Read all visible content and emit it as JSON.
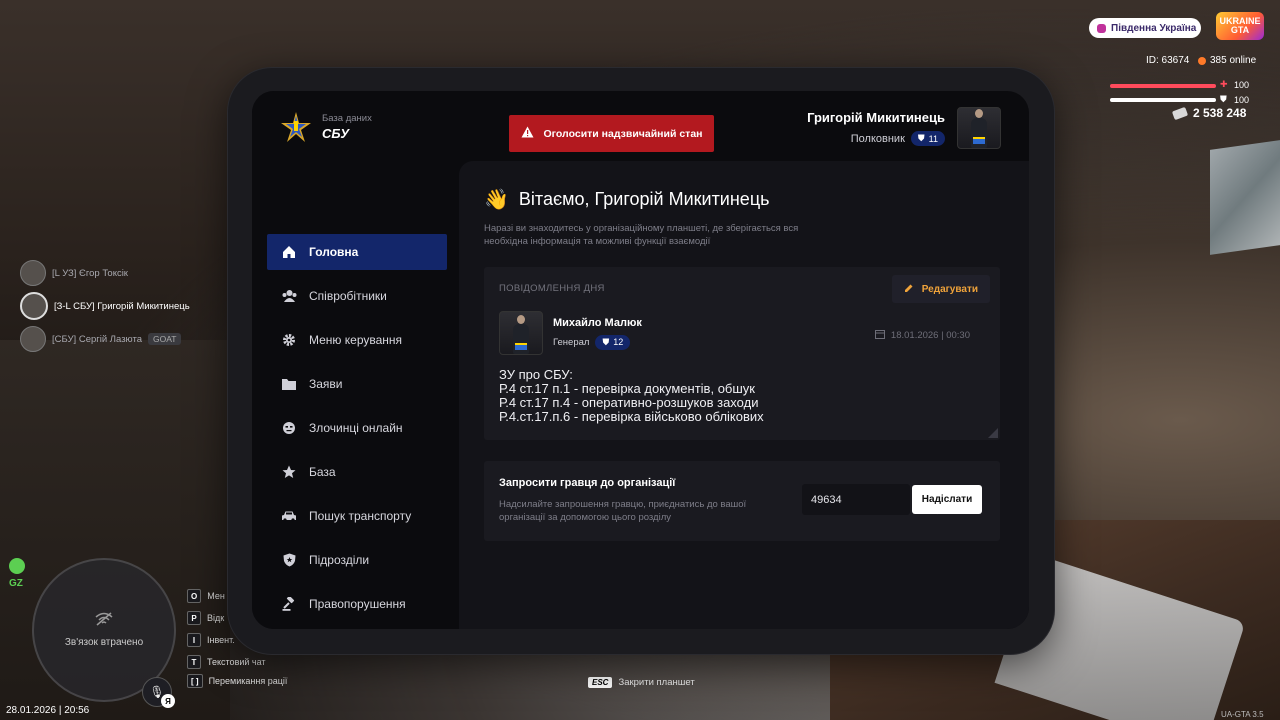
{
  "hud": {
    "server": "Південна Україна",
    "game_logo": "UKRAINE GTA",
    "player_id": "ID: 63674",
    "online": "385 online",
    "health": "100",
    "armor": "100",
    "money": "2 538 248"
  },
  "players": [
    {
      "name": "[L УЗ] Єгор Токсік",
      "tag": ""
    },
    {
      "name": "[З-L СБУ] Григорій Микитинець",
      "tag": ""
    },
    {
      "name": "[СБУ] Сергій Лазюта",
      "tag": "GOAT"
    }
  ],
  "minimap": {
    "zone": "GZ",
    "status": "Зв'язок втрачено",
    "datetime": "28.01.2026 | 20:56",
    "mic_key": "Я"
  },
  "hotkeys": [
    {
      "key": "O",
      "label": "Мен"
    },
    {
      "key": "P",
      "label": "Відк"
    },
    {
      "key": "I",
      "label": "Інвент."
    },
    {
      "key": "T",
      "label": "Текстовий чат"
    },
    {
      "key": "[ ]",
      "label": "Перемикання рації"
    }
  ],
  "esc_hint": {
    "key": "ESC",
    "label": "Закрити планшет"
  },
  "build": "UA-GTA 3.5",
  "tablet": {
    "brand_sub": "База даних",
    "brand_title": "СБУ",
    "emergency_label": "Оголосити надзвичайний стан",
    "user": {
      "name": "Григорій Микитинець",
      "rank": "Полковник",
      "level": "11"
    },
    "nav": [
      {
        "label": "Головна",
        "icon": "home-icon",
        "active": true
      },
      {
        "label": "Співробітники",
        "icon": "users-icon",
        "active": false
      },
      {
        "label": "Меню керування",
        "icon": "gear-icon",
        "active": false
      },
      {
        "label": "Заяви",
        "icon": "folder-icon",
        "active": false
      },
      {
        "label": "Злочинці онлайн",
        "icon": "criminal-icon",
        "active": false
      },
      {
        "label": "База",
        "icon": "star-icon",
        "active": false
      },
      {
        "label": "Пошук транспорту",
        "icon": "car-icon",
        "active": false
      },
      {
        "label": "Підрозділи",
        "icon": "shield-icon",
        "active": false
      },
      {
        "label": "Правопорушення",
        "icon": "gavel-icon",
        "active": false
      }
    ],
    "greeting": "Вітаємо, Григорій Микитинець",
    "greeting_icon": "👋",
    "intro": "Наразі ви знаходитесь у організаційному планшеті, де зберігається вся необхідна інформація та можливі функції взаємодії",
    "motd": {
      "heading": "ПОВІДОМЛЕННЯ ДНЯ",
      "edit_label": "Редагувати",
      "author": "Михайло Малюк",
      "author_rank": "Генерал",
      "author_level": "12",
      "date": "18.01.2026 | 00:30",
      "lines": [
        "ЗУ про СБУ:",
        "Р.4 ст.17 п.1 - перевірка документів, обшук",
        "Р.4 ст.17 п.4 - оперативно-розшуков заходи",
        "Р.4.ст.17.п.6 - перевірка військово облікових"
      ]
    },
    "invite": {
      "title": "Запросити гравця до організації",
      "description": "Надсилайте запрошення гравцю, приєднатись до вашої організації за допомогою цього розділу",
      "input_value": "49634",
      "send_label": "Надіслати"
    }
  },
  "colors": {
    "accent_blue": "#13266a",
    "emergency_red": "#b3191f",
    "edit_orange": "#f0a33a"
  }
}
